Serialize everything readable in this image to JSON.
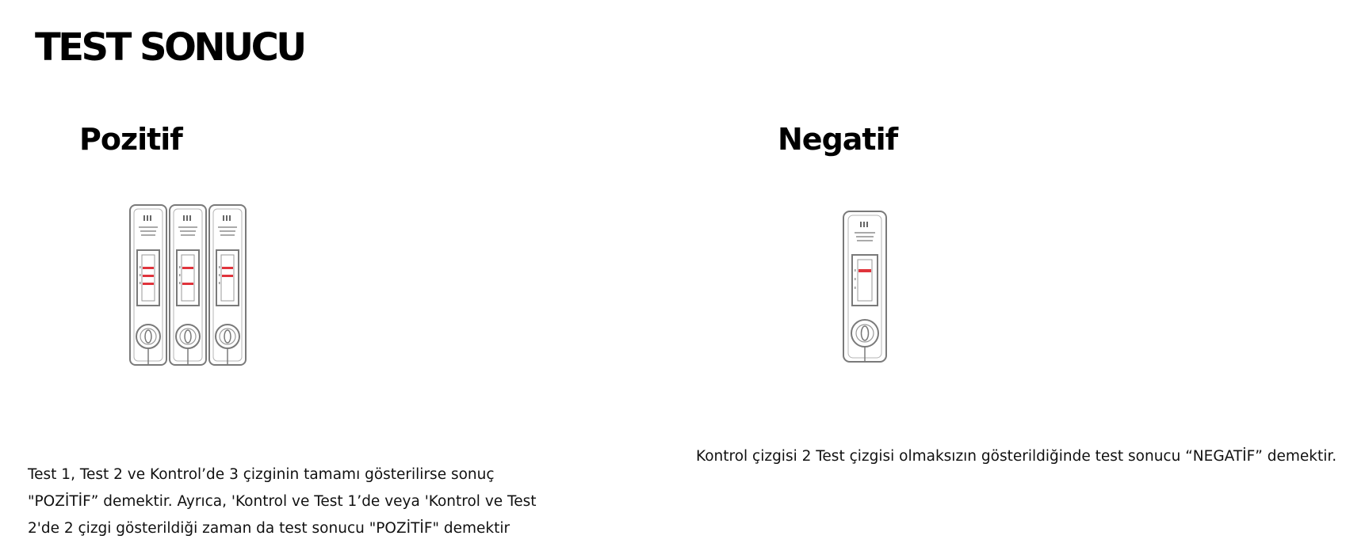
{
  "title": "TEST SONUCU",
  "positive": {
    "heading": "Pozitif",
    "illustration_icon": "covid-test-cassettes-positive-icon",
    "cassette_count": 3,
    "lines": [
      "Test 1, Test 2 ve Kontrol’de 3 çizginin tamamı gösterilirse sonuç",
      "\"POZİTİF” demektir. Ayrıca, 'Kontrol ve Test 1’de veya 'Kontrol ve Test",
      "2'de 2 çizgi gösterildiği zaman da test sonucu \"POZİTİF\" demektir"
    ]
  },
  "negative": {
    "heading": "Negatif",
    "illustration_icon": "covid-test-cassette-negative-icon",
    "cassette_count": 1,
    "description": "Kontrol çizgisi 2 Test çizgisi olmaksızın gösterildiğinde test sonucu “NEGATİF” demektir."
  },
  "colors": {
    "result_line": "#e0343c",
    "outline": "#7a7a7a"
  }
}
